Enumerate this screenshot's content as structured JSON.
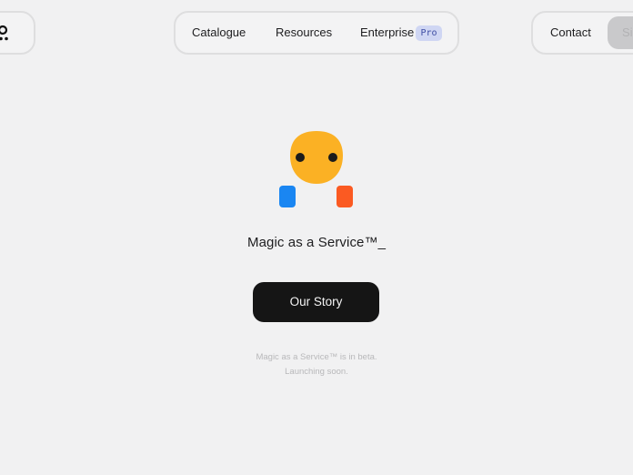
{
  "header": {
    "nav": {
      "items": [
        {
          "label": "Catalogue"
        },
        {
          "label": "Resources"
        },
        {
          "label": "Enterprise"
        }
      ],
      "badge": "Pro"
    },
    "contact_label": "Contact",
    "signin_label": "Si"
  },
  "hero": {
    "tagline": "Magic as a Service™_",
    "cta_label": "Our Story",
    "note_line1": "Magic as a Service™ is in beta.",
    "note_line2": "Launching soon."
  },
  "colors": {
    "background": "#f1f1f2",
    "mascot_face": "#fbb124",
    "mascot_left_hand": "#1a86f2",
    "mascot_right_hand": "#fb5a22",
    "cta_background": "#151515",
    "badge_background": "#cfd6f3"
  },
  "icons": {
    "logo": "logo-mark-icon",
    "mascot": "mascot-illustration"
  }
}
